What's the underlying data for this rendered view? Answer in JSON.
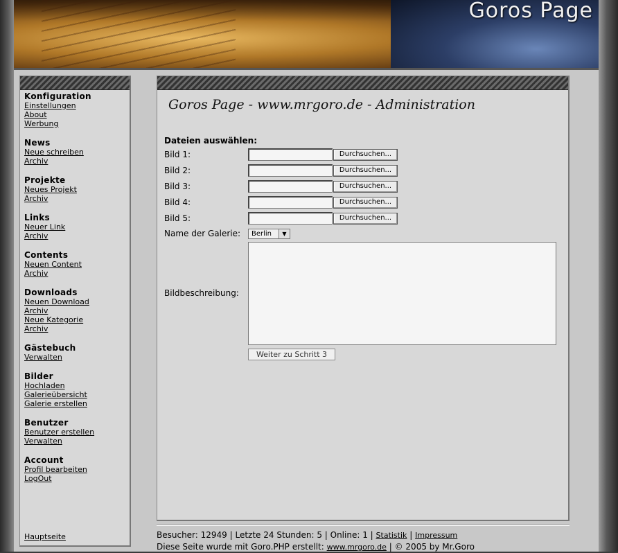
{
  "banner": {
    "title": "Goros Page"
  },
  "sidebar": {
    "groups": [
      {
        "title": "Konfiguration",
        "items": [
          "Einstellungen",
          "About",
          "Werbung"
        ]
      },
      {
        "title": "News",
        "items": [
          "Neue schreiben",
          "Archiv"
        ]
      },
      {
        "title": "Projekte",
        "items": [
          "Neues Projekt",
          "Archiv"
        ]
      },
      {
        "title": "Links",
        "items": [
          "Neuer Link",
          "Archiv"
        ]
      },
      {
        "title": "Contents",
        "items": [
          "Neuen Content",
          "Archiv"
        ]
      },
      {
        "title": "Downloads",
        "items": [
          "Neuen Download",
          "Archiv",
          "Neue Kategorie",
          "Archiv"
        ]
      },
      {
        "title": "Gästebuch",
        "items": [
          "Verwalten"
        ]
      },
      {
        "title": "Bilder",
        "items": [
          "Hochladen",
          "Galerieübersicht",
          "Galerie erstellen"
        ]
      },
      {
        "title": "Benutzer",
        "items": [
          "Benutzer erstellen",
          "Verwalten"
        ]
      },
      {
        "title": "Account",
        "items": [
          "Profil bearbeiten",
          "LogOut"
        ]
      }
    ],
    "home": "Hauptseite"
  },
  "main": {
    "title": "Goros Page - www.mrgoro.de - Administration",
    "form_heading": "Dateien auswählen:",
    "file_rows": [
      {
        "label": "Bild 1:",
        "button": "Durchsuchen..."
      },
      {
        "label": "Bild 2:",
        "button": "Durchsuchen..."
      },
      {
        "label": "Bild 3:",
        "button": "Durchsuchen..."
      },
      {
        "label": "Bild 4:",
        "button": "Durchsuchen..."
      },
      {
        "label": "Bild 5:",
        "button": "Durchsuchen..."
      }
    ],
    "gallery_label": "Name der Galerie:",
    "gallery_selected": "Berlin",
    "description_label": "Bildbeschreibung:",
    "submit_label": "Weiter zu Schritt 3"
  },
  "footer": {
    "stats_text": "Besucher: 12949 | Letzte 24 Stunden: 5 | Online: 1 |",
    "statistik_link": "Statistik",
    "separator": "|",
    "impressum_link": "Impressum",
    "credit_prefix": "Diese Seite wurde mit Goro.PHP erstellt:",
    "site_link": "www.mrgoro.de",
    "credit_suffix": "| © 2005 by Mr.Goro"
  }
}
